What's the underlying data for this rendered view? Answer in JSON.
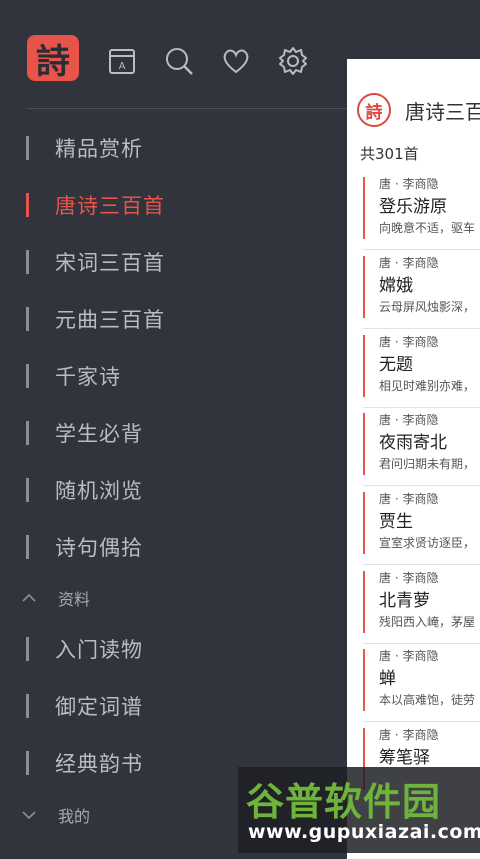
{
  "app": {
    "logo_char": "詩"
  },
  "toolbar": {
    "icons": [
      "book-icon",
      "search-icon",
      "heart-icon",
      "settings-icon"
    ]
  },
  "sidebar": {
    "items": [
      {
        "label": "精品赏析",
        "active": false
      },
      {
        "label": "唐诗三百首",
        "active": true
      },
      {
        "label": "宋词三百首",
        "active": false
      },
      {
        "label": "元曲三百首",
        "active": false
      },
      {
        "label": "千家诗",
        "active": false
      },
      {
        "label": "学生必背",
        "active": false
      },
      {
        "label": "随机浏览",
        "active": false
      },
      {
        "label": "诗句偶拾",
        "active": false
      }
    ],
    "section_materials": "资料",
    "materials": [
      {
        "label": "入门读物"
      },
      {
        "label": "御定词谱"
      },
      {
        "label": "经典韵书"
      }
    ],
    "section_mine": "我的"
  },
  "panel": {
    "seal_char": "詩",
    "title": "唐诗三百",
    "count": "共301首",
    "poems": [
      {
        "meta": "唐 · 李商隐",
        "title": "登乐游原",
        "excerpt": "向晚意不适，驱车"
      },
      {
        "meta": "唐 · 李商隐",
        "title": "嫦娥",
        "excerpt": "云母屏风烛影深，"
      },
      {
        "meta": "唐 · 李商隐",
        "title": "无题",
        "excerpt": "相见时难别亦难，"
      },
      {
        "meta": "唐 · 李商隐",
        "title": "夜雨寄北",
        "excerpt": "君问归期未有期，"
      },
      {
        "meta": "唐 · 李商隐",
        "title": "贾生",
        "excerpt": "宣室求贤访逐臣，"
      },
      {
        "meta": "唐 · 李商隐",
        "title": "北青萝",
        "excerpt": "残阳西入崦，茅屋"
      },
      {
        "meta": "唐 · 李商隐",
        "title": "蝉",
        "excerpt": "本以高难饱，徒劳"
      },
      {
        "meta": "唐 · 李商隐",
        "title": "筹笔驿",
        "excerpt": ""
      }
    ]
  },
  "watermark": {
    "title": "谷普软件园",
    "url": "www.gupuxiazai.com"
  },
  "colors": {
    "accent": "#e8534a",
    "background": "#31343c",
    "panel": "#ffffff"
  }
}
